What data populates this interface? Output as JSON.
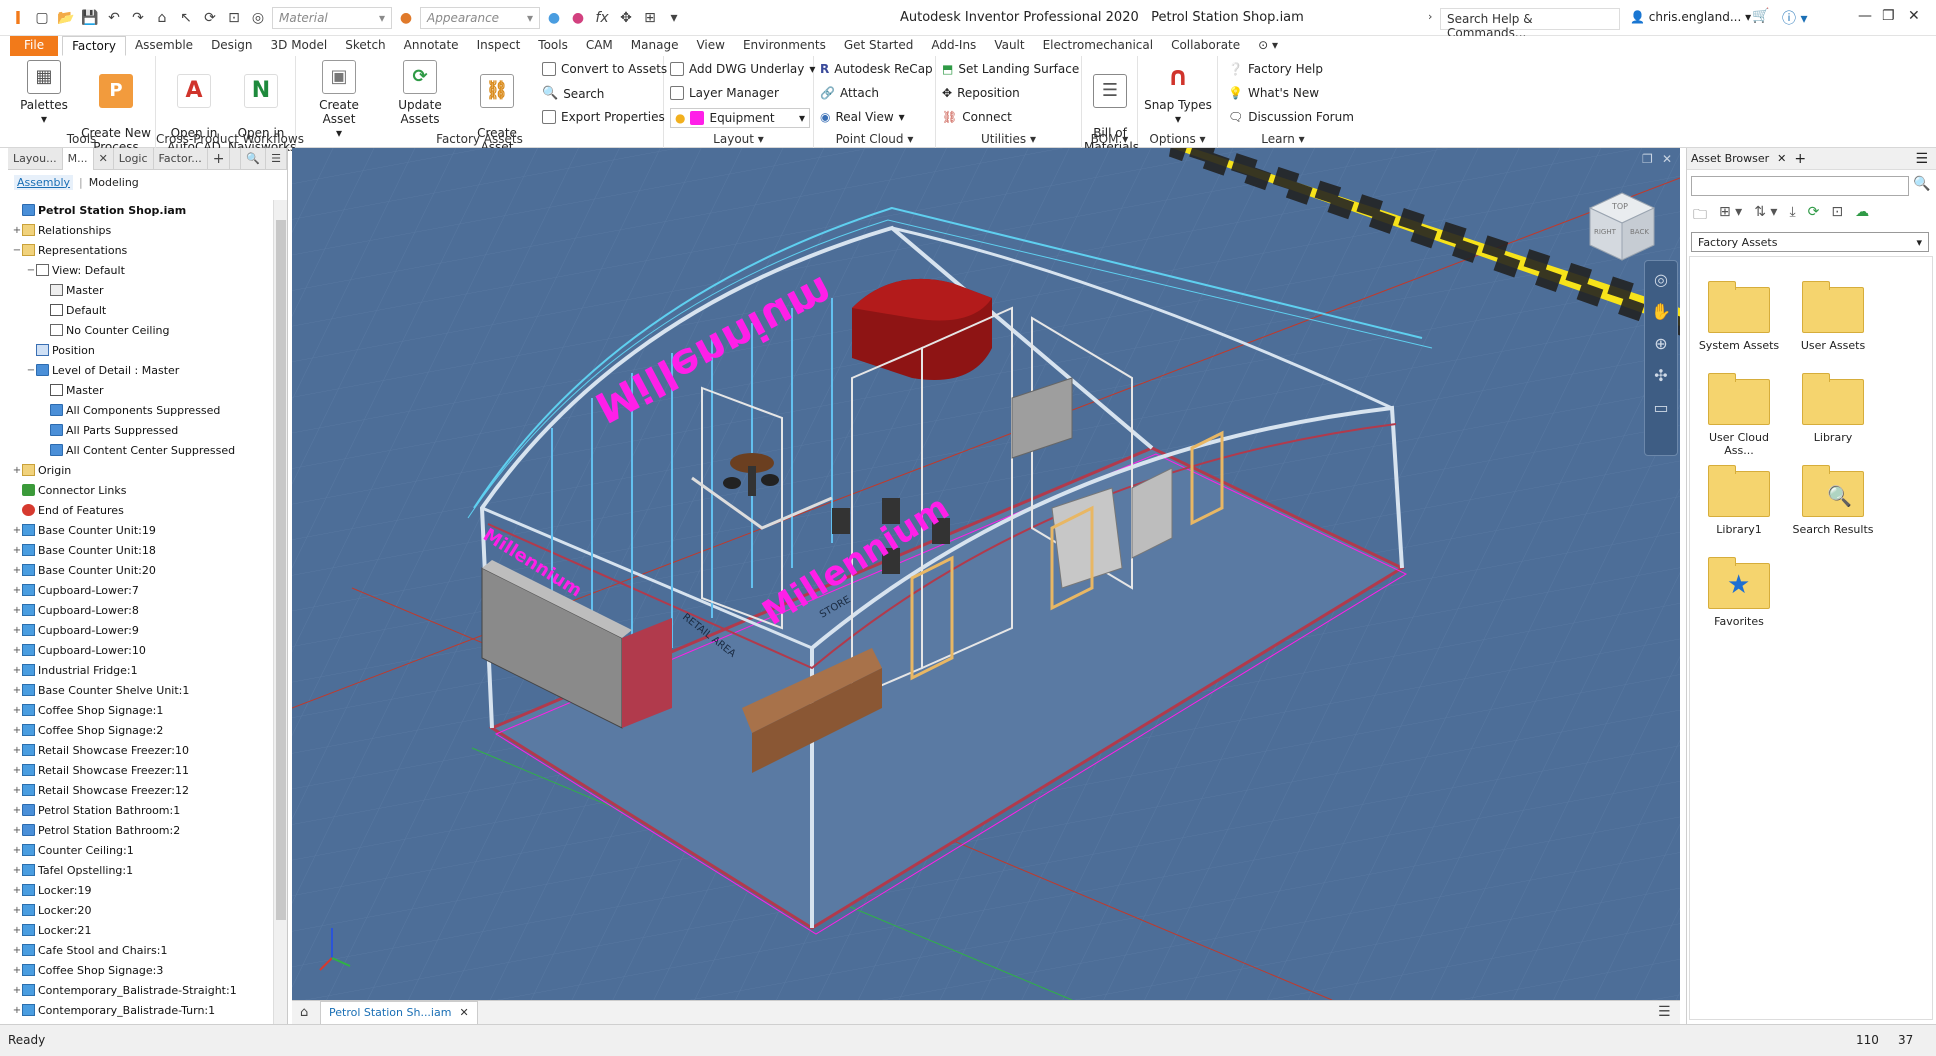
{
  "app": {
    "title": "Autodesk Inventor Professional 2020",
    "document": "Petrol Station Shop.iam",
    "search_placeholder": "Search Help & Commands...",
    "user": "chris.england..."
  },
  "qat": {
    "material": "Material",
    "appearance": "Appearance",
    "fx": "fx"
  },
  "tabs": [
    "Factory",
    "Assemble",
    "Design",
    "3D Model",
    "Sketch",
    "Annotate",
    "Inspect",
    "Tools",
    "CAM",
    "Manage",
    "View",
    "Environments",
    "Get Started",
    "Add-Ins",
    "Vault",
    "Electromechanical",
    "Collaborate"
  ],
  "file_tab": "File",
  "ribbon": {
    "tools": {
      "label": "Tools",
      "palettes": "Palettes",
      "create_process": "Create New\nProcess Model"
    },
    "cross": {
      "label": "Cross-Product Workflows",
      "autocad": "Open in\nAutoCAD",
      "navisworks": "Open in\nNavisworks"
    },
    "factory_assets": {
      "label": "Factory Assets",
      "create_asset": "Create Asset",
      "update_assets": "Update Assets",
      "create_chain": "Create Asset\nChain",
      "convert": "Convert to Assets",
      "search": "Search",
      "export": "Export Properties"
    },
    "layout": {
      "label": "Layout",
      "add_dwg": "Add DWG Underlay",
      "layer_manager": "Layer Manager",
      "layer_value": "Equipment"
    },
    "point_cloud": {
      "label": "Point Cloud",
      "recap": "Autodesk  ReCap",
      "attach": "Attach",
      "real_view": "Real View"
    },
    "utilities": {
      "label": "Utilities",
      "landing": "Set Landing Surface",
      "reposition": "Reposition",
      "connect": "Connect"
    },
    "bom": {
      "label": "BOM",
      "bill": "Bill of\nMaterials"
    },
    "options": {
      "label": "Options",
      "snap": "Snap Types"
    },
    "learn": {
      "label": "Learn",
      "help": "Factory Help",
      "whats_new": "What's New",
      "forum": "Discussion Forum"
    }
  },
  "left_panel": {
    "tabs": [
      "Layou...",
      "M...",
      "Logic",
      "Factor..."
    ],
    "subtabs": [
      "Assembly",
      "Modeling"
    ],
    "tree": [
      {
        "t": "Petrol Station Shop.iam",
        "lvl": 0,
        "exp": "",
        "icon": "asm",
        "bold": true
      },
      {
        "t": "Relationships",
        "lvl": 0,
        "exp": "+",
        "icon": "fold"
      },
      {
        "t": "Representations",
        "lvl": 0,
        "exp": "−",
        "icon": "fold"
      },
      {
        "t": "View: Default",
        "lvl": 1,
        "exp": "−",
        "icon": "view"
      },
      {
        "t": "Master",
        "lvl": 2,
        "exp": "",
        "icon": "lock"
      },
      {
        "t": "Default",
        "lvl": 2,
        "exp": "",
        "icon": "chk"
      },
      {
        "t": "No Counter Ceiling",
        "lvl": 2,
        "exp": "",
        "icon": "view"
      },
      {
        "t": "Position",
        "lvl": 1,
        "exp": "",
        "icon": "pos"
      },
      {
        "t": "Level of Detail : Master",
        "lvl": 1,
        "exp": "−",
        "icon": "asm"
      },
      {
        "t": "Master",
        "lvl": 2,
        "exp": "",
        "icon": "chk"
      },
      {
        "t": "All Components Suppressed",
        "lvl": 2,
        "exp": "",
        "icon": "asm"
      },
      {
        "t": "All Parts Suppressed",
        "lvl": 2,
        "exp": "",
        "icon": "asm"
      },
      {
        "t": "All Content Center Suppressed",
        "lvl": 2,
        "exp": "",
        "icon": "asm"
      },
      {
        "t": "Origin",
        "lvl": 0,
        "exp": "+",
        "icon": "fold"
      },
      {
        "t": "Connector Links",
        "lvl": 0,
        "exp": "",
        "icon": "link"
      },
      {
        "t": "End of Features",
        "lvl": 0,
        "exp": "",
        "icon": "err"
      },
      {
        "t": "Base Counter Unit:19",
        "lvl": 0,
        "exp": "+",
        "icon": "part"
      },
      {
        "t": "Base Counter Unit:18",
        "lvl": 0,
        "exp": "+",
        "icon": "part"
      },
      {
        "t": "Base Counter Unit:20",
        "lvl": 0,
        "exp": "+",
        "icon": "part"
      },
      {
        "t": "Cupboard-Lower:7",
        "lvl": 0,
        "exp": "+",
        "icon": "part"
      },
      {
        "t": "Cupboard-Lower:8",
        "lvl": 0,
        "exp": "+",
        "icon": "part"
      },
      {
        "t": "Cupboard-Lower:9",
        "lvl": 0,
        "exp": "+",
        "icon": "part"
      },
      {
        "t": "Cupboard-Lower:10",
        "lvl": 0,
        "exp": "+",
        "icon": "part"
      },
      {
        "t": "Industrial Fridge:1",
        "lvl": 0,
        "exp": "+",
        "icon": "part"
      },
      {
        "t": "Base Counter Shelve Unit:1",
        "lvl": 0,
        "exp": "+",
        "icon": "part"
      },
      {
        "t": "Coffee Shop Signage:1",
        "lvl": 0,
        "exp": "+",
        "icon": "part"
      },
      {
        "t": "Coffee Shop Signage:2",
        "lvl": 0,
        "exp": "+",
        "icon": "part"
      },
      {
        "t": "Retail Showcase Freezer:10",
        "lvl": 0,
        "exp": "+",
        "icon": "part"
      },
      {
        "t": "Retail Showcase Freezer:11",
        "lvl": 0,
        "exp": "+",
        "icon": "part"
      },
      {
        "t": "Retail Showcase Freezer:12",
        "lvl": 0,
        "exp": "+",
        "icon": "part"
      },
      {
        "t": "Petrol Station Bathroom:1",
        "lvl": 0,
        "exp": "+",
        "icon": "asm"
      },
      {
        "t": "Petrol Station Bathroom:2",
        "lvl": 0,
        "exp": "+",
        "icon": "asm"
      },
      {
        "t": "Counter Ceiling:1",
        "lvl": 0,
        "exp": "+",
        "icon": "part"
      },
      {
        "t": "Tafel Opstelling:1",
        "lvl": 0,
        "exp": "+",
        "icon": "part"
      },
      {
        "t": "Locker:19",
        "lvl": 0,
        "exp": "+",
        "icon": "part"
      },
      {
        "t": "Locker:20",
        "lvl": 0,
        "exp": "+",
        "icon": "part"
      },
      {
        "t": "Locker:21",
        "lvl": 0,
        "exp": "+",
        "icon": "part"
      },
      {
        "t": "Cafe Stool and Chairs:1",
        "lvl": 0,
        "exp": "+",
        "icon": "part"
      },
      {
        "t": "Coffee Shop Signage:3",
        "lvl": 0,
        "exp": "+",
        "icon": "part"
      },
      {
        "t": "Contemporary_Balistrade-Straight:1",
        "lvl": 0,
        "exp": "+",
        "icon": "part"
      },
      {
        "t": "Contemporary_Balistrade-Turn:1",
        "lvl": 0,
        "exp": "+",
        "icon": "part"
      }
    ]
  },
  "right_panel": {
    "title": "Asset Browser",
    "dropdown": "Factory Assets",
    "folders": [
      "System Assets",
      "User Assets",
      "User Cloud Ass...",
      "Library",
      "Library1",
      "Search Results",
      "Favorites"
    ]
  },
  "viewcube": {
    "top": "TOP",
    "right": "RIGHT",
    "back": "BACK"
  },
  "viewport_labels": {
    "sign": "Millennium",
    "retail_area": "RETAIL AREA",
    "store": "STORE"
  },
  "doc_tab": "Petrol Station Sh...iam",
  "status": {
    "text": "Ready",
    "n1": "110",
    "n2": "37"
  },
  "colors": {
    "viewport_bg": "#4d6e98",
    "accent": "#f27a1a",
    "magenta": "#ff1fe8"
  }
}
